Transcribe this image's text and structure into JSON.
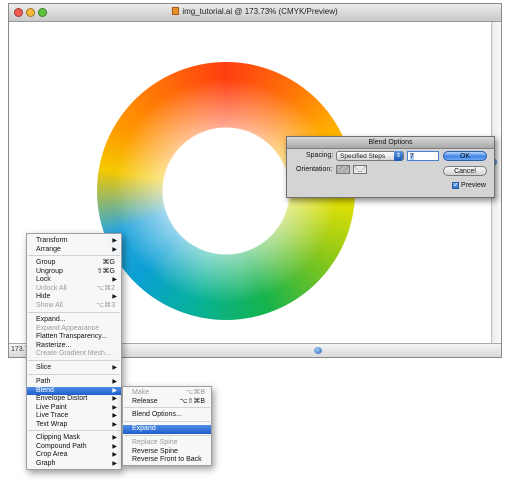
{
  "window": {
    "title": "img_tutorial.ai @ 173.73% (CMYK/Preview)",
    "zoom": "173.73",
    "traffic_lights": {
      "close": "#f05a4e",
      "minimize": "#f5b738",
      "zoom": "#5bc23f"
    }
  },
  "dialog": {
    "title": "Blend Options",
    "spacing_label": "Spacing:",
    "spacing_value": "Specified Steps",
    "steps_value": "7",
    "ok_label": "OK",
    "cancel_label": "Cancel",
    "orientation_label": "Orientation:",
    "preview_label": "Preview",
    "preview_checked": true
  },
  "context_menu": {
    "items": [
      {
        "label": "Transform",
        "shortcut": "",
        "submenu": true,
        "disabled": false
      },
      {
        "label": "Arrange",
        "shortcut": "",
        "submenu": true,
        "disabled": false
      },
      {
        "label": "Group",
        "shortcut": "⌘G",
        "submenu": false,
        "disabled": false
      },
      {
        "label": "Ungroup",
        "shortcut": "⇧⌘G",
        "submenu": false,
        "disabled": false
      },
      {
        "label": "Lock",
        "shortcut": "",
        "submenu": true,
        "disabled": false
      },
      {
        "label": "Unlock All",
        "shortcut": "⌥⌘2",
        "submenu": false,
        "disabled": true
      },
      {
        "label": "Hide",
        "shortcut": "",
        "submenu": true,
        "disabled": false
      },
      {
        "label": "Show All",
        "shortcut": "⌥⌘3",
        "submenu": false,
        "disabled": true
      },
      {
        "label": "Expand...",
        "shortcut": "",
        "submenu": false,
        "disabled": false
      },
      {
        "label": "Expand Appearance",
        "shortcut": "",
        "submenu": false,
        "disabled": true
      },
      {
        "label": "Flatten Transparency...",
        "shortcut": "",
        "submenu": false,
        "disabled": false
      },
      {
        "label": "Rasterize...",
        "shortcut": "",
        "submenu": false,
        "disabled": false
      },
      {
        "label": "Create Gradient Mesh...",
        "shortcut": "",
        "submenu": false,
        "disabled": true
      },
      {
        "label": "Slice",
        "shortcut": "",
        "submenu": true,
        "disabled": false
      },
      {
        "label": "Path",
        "shortcut": "",
        "submenu": true,
        "disabled": false
      },
      {
        "label": "Blend",
        "shortcut": "",
        "submenu": true,
        "disabled": false,
        "highlighted": true
      },
      {
        "label": "Envelope Distort",
        "shortcut": "",
        "submenu": true,
        "disabled": false
      },
      {
        "label": "Live Paint",
        "shortcut": "",
        "submenu": true,
        "disabled": false
      },
      {
        "label": "Live Trace",
        "shortcut": "",
        "submenu": true,
        "disabled": false
      },
      {
        "label": "Text Wrap",
        "shortcut": "",
        "submenu": true,
        "disabled": false
      },
      {
        "label": "Clipping Mask",
        "shortcut": "",
        "submenu": true,
        "disabled": false
      },
      {
        "label": "Compound Path",
        "shortcut": "",
        "submenu": true,
        "disabled": false
      },
      {
        "label": "Crop Area",
        "shortcut": "",
        "submenu": true,
        "disabled": false
      },
      {
        "label": "Graph",
        "shortcut": "",
        "submenu": true,
        "disabled": false
      }
    ]
  },
  "blend_submenu": {
    "items": [
      {
        "label": "Make",
        "shortcut": "⌥⌘B",
        "disabled": true
      },
      {
        "label": "Release",
        "shortcut": "⌥⇧⌘B",
        "disabled": false
      },
      {
        "label": "Blend Options...",
        "shortcut": "",
        "disabled": false
      },
      {
        "label": "Expand",
        "shortcut": "",
        "disabled": false,
        "highlighted": true
      },
      {
        "label": "Replace Spine",
        "shortcut": "",
        "disabled": true
      },
      {
        "label": "Reverse Spine",
        "shortcut": "",
        "disabled": false
      },
      {
        "label": "Reverse Front to Back",
        "shortcut": "",
        "disabled": false
      }
    ]
  }
}
